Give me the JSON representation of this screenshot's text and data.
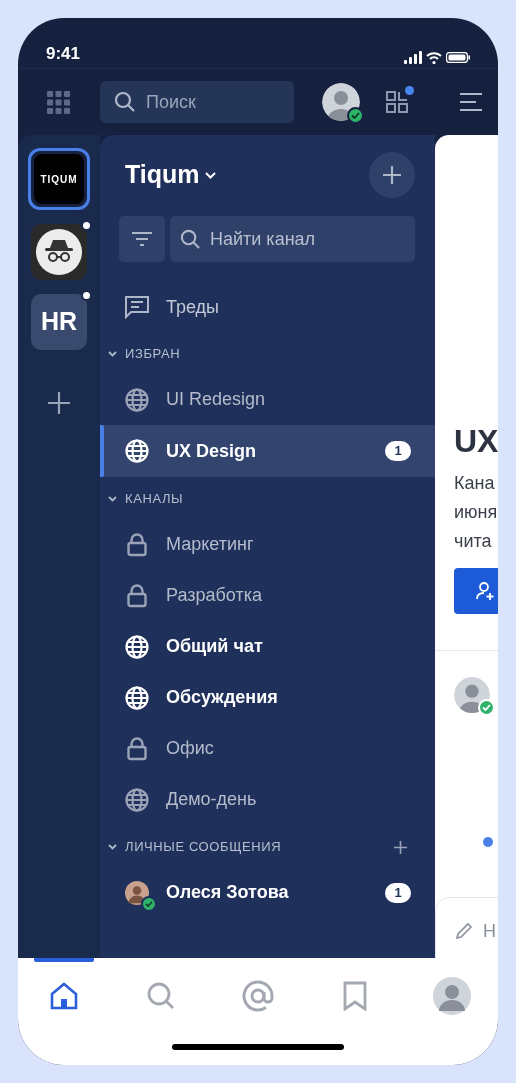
{
  "status_bar": {
    "time": "9:41"
  },
  "top_bar": {
    "search": {
      "placeholder": "Поиск"
    },
    "user_online": true,
    "apps_notification": true
  },
  "workspaces": [
    {
      "kind": "logo",
      "label": "TIQUM",
      "selected": true,
      "unread": false
    },
    {
      "kind": "incognito",
      "selected": false,
      "unread": true
    },
    {
      "kind": "initials",
      "label": "HR",
      "selected": false,
      "unread": true
    }
  ],
  "sidebar": {
    "workspace_name": "Tiqum",
    "search": {
      "placeholder": "Найти канал"
    },
    "threads": "Треды",
    "sections": [
      {
        "title": "ИЗБРАН",
        "expanded": true,
        "can_add": false,
        "items": [
          {
            "kind": "public",
            "name": "UI Redesign",
            "selected": false,
            "unread": false
          },
          {
            "kind": "public",
            "name": "UX Design",
            "selected": true,
            "unread": false,
            "badge": "1"
          }
        ]
      },
      {
        "title": "КАНАЛЫ",
        "expanded": true,
        "can_add": false,
        "items": [
          {
            "kind": "private",
            "name": "Маркетинг",
            "selected": false,
            "unread": false
          },
          {
            "kind": "private",
            "name": "Разработка",
            "selected": false,
            "unread": false
          },
          {
            "kind": "public",
            "name": "Общий чат",
            "selected": false,
            "unread": true
          },
          {
            "kind": "public",
            "name": "Обсуждения",
            "selected": false,
            "unread": true
          },
          {
            "kind": "private",
            "name": "Офис",
            "selected": false,
            "unread": false
          },
          {
            "kind": "public",
            "name": "Демо-день",
            "selected": false,
            "unread": false
          }
        ]
      },
      {
        "title": "ЛИЧНЫЕ СООБЩЕНИЯ",
        "expanded": true,
        "can_add": true,
        "items": [
          {
            "kind": "dm",
            "name": "Олеся Зотова",
            "selected": false,
            "unread": true,
            "online": true,
            "badge": "1"
          }
        ]
      }
    ]
  },
  "content": {
    "title": "UX",
    "description": [
      "Кана",
      "июня",
      "чита"
    ],
    "message": {
      "author_online": true,
      "unread": true
    },
    "composer": {
      "placeholder": "Н"
    }
  },
  "bottom_nav": [
    {
      "kind": "home",
      "selected": true
    },
    {
      "kind": "search",
      "selected": false
    },
    {
      "kind": "mentions",
      "selected": false
    },
    {
      "kind": "saved",
      "selected": false
    },
    {
      "kind": "profile",
      "selected": false
    }
  ]
}
